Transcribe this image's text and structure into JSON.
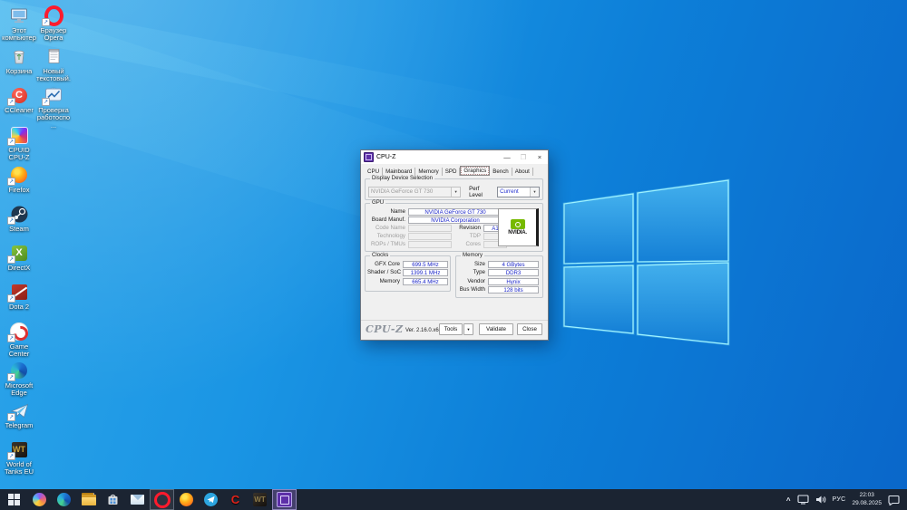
{
  "wallpaper": {
    "base_color": "#0d7fd8",
    "logo_stroke": "#8feeff",
    "style": "windows-10-light-blue"
  },
  "desktop": {
    "icons": [
      {
        "name": "this-pc",
        "label": "Этот компьютер"
      },
      {
        "name": "opera-browser",
        "label": "Браузер Opera"
      },
      {
        "name": "recycle-bin",
        "label": "Корзина"
      },
      {
        "name": "new-text-document",
        "label": "Новый текстовый..."
      },
      {
        "name": "ccleaner",
        "label": "CCleaner"
      },
      {
        "name": "health-check",
        "label": "Проверка работоспо..."
      },
      {
        "name": "cpuid-cpu-z",
        "label": "CPUID CPU-Z"
      },
      {
        "name": "firefox",
        "label": "Firefox"
      },
      {
        "name": "steam",
        "label": "Steam"
      },
      {
        "name": "directx",
        "label": "DirectX"
      },
      {
        "name": "dota-2",
        "label": "Dota 2"
      },
      {
        "name": "game-center",
        "label": "Game Center"
      },
      {
        "name": "microsoft-edge",
        "label": "Microsoft Edge"
      },
      {
        "name": "telegram",
        "label": "Telegram"
      },
      {
        "name": "world-of-tanks-eu",
        "label": "World of Tanks EU"
      }
    ]
  },
  "window": {
    "title": "CPU-Z",
    "controls": {
      "minimize": "—",
      "maximize": "❐",
      "close": "×"
    },
    "tabs": [
      "CPU",
      "Mainboard",
      "Memory",
      "SPD",
      "Graphics",
      "Bench",
      "About"
    ],
    "active_tab": "Graphics",
    "display_device_selection": {
      "label": "Display Device Selection",
      "device": "NVIDIA GeForce GT 730",
      "perf_level_label": "Perf Level",
      "perf_level_value": "Current"
    },
    "gpu": {
      "label": "GPU",
      "name_label": "Name",
      "name": "NVIDIA GeForce GT 730",
      "board_label": "Board Manuf.",
      "board": "NVIDIA Corporation",
      "code_name_label": "Code Name",
      "code_name": "",
      "revision_label": "Revision",
      "revision": "A1",
      "technology_label": "Technology",
      "technology": "",
      "tdp_label": "TDP",
      "tdp": "",
      "rops_label": "ROPs / TMUs",
      "rops": "",
      "cores_label": "Cores",
      "cores": "",
      "vendor_logo_text": "NVIDIA."
    },
    "clocks": {
      "label": "Clocks",
      "rows": [
        {
          "label": "GFX Core",
          "value": "699.5 MHz"
        },
        {
          "label": "Shader / SoC",
          "value": "1399.1 MHz"
        },
        {
          "label": "Memory",
          "value": "665.4 MHz"
        }
      ]
    },
    "memory": {
      "label": "Memory",
      "rows": [
        {
          "label": "Size",
          "value": "4 GBytes"
        },
        {
          "label": "Type",
          "value": "DDR3"
        },
        {
          "label": "Vendor",
          "value": "Hynix"
        },
        {
          "label": "Bus Width",
          "value": "128 bits"
        }
      ]
    },
    "footer": {
      "logo": "CPU-Z",
      "version": "Ver. 2.16.0.x64",
      "tools": "Tools",
      "validate": "Validate",
      "close": "Close"
    }
  },
  "taskbar": {
    "icons": [
      "start",
      "copilot",
      "microsoft-edge",
      "file-explorer",
      "microsoft-store",
      "mail",
      "opera",
      "firefox",
      "telegram",
      "ccleaner",
      "world-of-tanks",
      "cpu-z"
    ],
    "running_apps": [
      "opera",
      "cpu-z"
    ],
    "focused_app": "cpu-z",
    "tray": {
      "hidden_icons_chevron": "^",
      "lang": "РУС",
      "time": "22:03",
      "date": "29.08.2025"
    }
  }
}
